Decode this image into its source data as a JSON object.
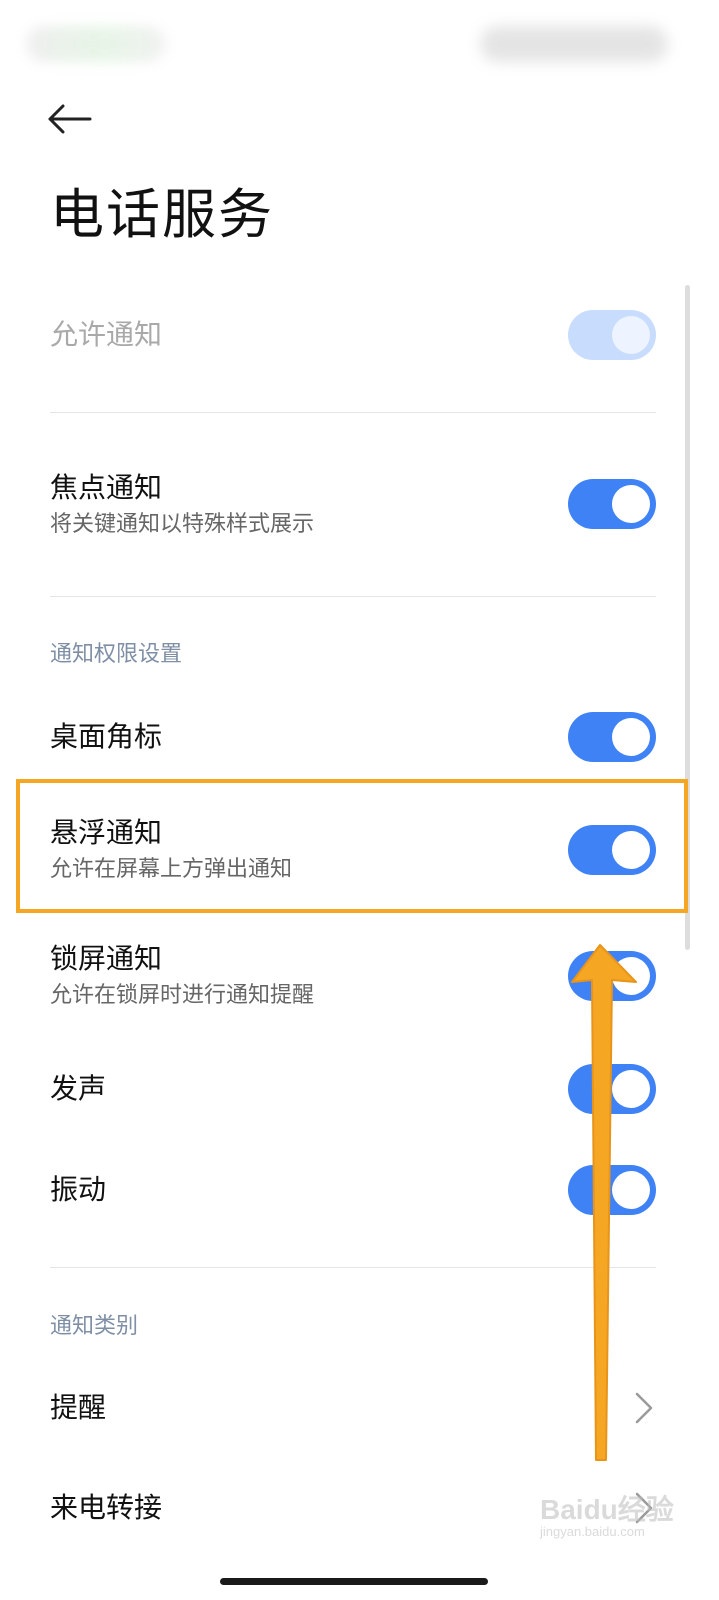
{
  "header": {
    "title": "电话服务",
    "back_icon": "arrow-left-icon"
  },
  "rows": {
    "allow_notifications": {
      "label": "允许通知",
      "on": true,
      "disabled": true
    },
    "focus_notifications": {
      "label": "焦点通知",
      "subtitle": "将关键通知以特殊样式展示",
      "on": true
    },
    "app_badge": {
      "label": "桌面角标",
      "on": true
    },
    "floating_notifications": {
      "label": "悬浮通知",
      "subtitle": "允许在屏幕上方弹出通知",
      "on": true
    },
    "lockscreen_notifications": {
      "label": "锁屏通知",
      "subtitle": "允许在锁屏时进行通知提醒",
      "on": true
    },
    "sound": {
      "label": "发声",
      "on": true
    },
    "vibrate": {
      "label": "振动",
      "on": true
    },
    "reminder": {
      "label": "提醒",
      "icon": "chevron-right-icon"
    },
    "call_forwarding": {
      "label": "来电转接",
      "icon": "chevron-right-icon"
    }
  },
  "sections": {
    "permissions": "通知权限设置",
    "categories": "通知类别"
  },
  "watermark": {
    "main": "Baidu经验",
    "sub": "jingyan.baidu.com"
  },
  "colors": {
    "toggle_on": "#3f82f5",
    "toggle_disabled": "#c8dcfd",
    "highlight": "#f5a623",
    "section_header": "#7f8fa6"
  }
}
